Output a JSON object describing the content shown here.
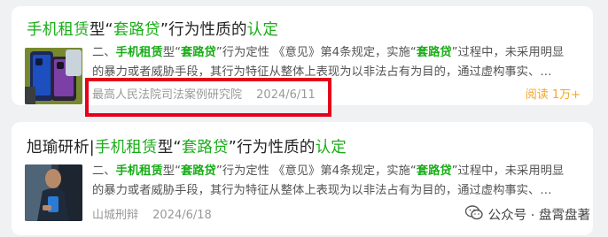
{
  "results": [
    {
      "title_parts": [
        {
          "text": "手机租赁",
          "hl": true
        },
        {
          "text": "型“",
          "hl": false
        },
        {
          "text": "套路贷",
          "hl": true
        },
        {
          "text": "”行为性质的",
          "hl": false
        },
        {
          "text": "认定",
          "hl": true
        }
      ],
      "snippet_line1": [
        {
          "text": "二、",
          "hl": false
        },
        {
          "text": "手机租赁",
          "hl": true
        },
        {
          "text": "型“",
          "hl": false
        },
        {
          "text": "套路贷",
          "hl": true
        },
        {
          "text": "”行为定性 《意见》第4条规定，实施“",
          "hl": false
        },
        {
          "text": "套路贷",
          "hl": true
        },
        {
          "text": "”过程中，未采用明显",
          "hl": false
        }
      ],
      "snippet_line2": "的暴力或者威胁手段，其行为特征从整体上表现为以非法占有为目的，通过虚构事实、…",
      "source": "最高人民法院司法案例研究院",
      "date": "2024/6/11",
      "reads": "阅读 1万+"
    },
    {
      "title_parts": [
        {
          "text": "旭瑜研析|",
          "hl": false
        },
        {
          "text": "手机租赁",
          "hl": true
        },
        {
          "text": "型“",
          "hl": false
        },
        {
          "text": "套路贷",
          "hl": true
        },
        {
          "text": "”行为性质的",
          "hl": false
        },
        {
          "text": "认定",
          "hl": true
        }
      ],
      "snippet_line1": [
        {
          "text": "二、",
          "hl": false
        },
        {
          "text": "手机租赁",
          "hl": true
        },
        {
          "text": "型“",
          "hl": false
        },
        {
          "text": "套路贷",
          "hl": true
        },
        {
          "text": "”行为定性 《意见》第4条规定，实施“",
          "hl": false
        },
        {
          "text": "套路贷",
          "hl": true
        },
        {
          "text": "”过程中，未采用明显",
          "hl": false
        }
      ],
      "snippet_line2": "的暴力或者威胁手段，其行为特征从整体上表现为以非法占有为目的，通过虚构事实、…",
      "source": "山城刑辩",
      "date": "2024/6/18"
    }
  ],
  "watermark": "公众号 · 盘霄盘著",
  "colors": {
    "highlight": "#1aad19",
    "reads": "#f5a623",
    "annotation_box": "#e6001b"
  },
  "icons": {
    "watermark": "wechat-icon"
  }
}
